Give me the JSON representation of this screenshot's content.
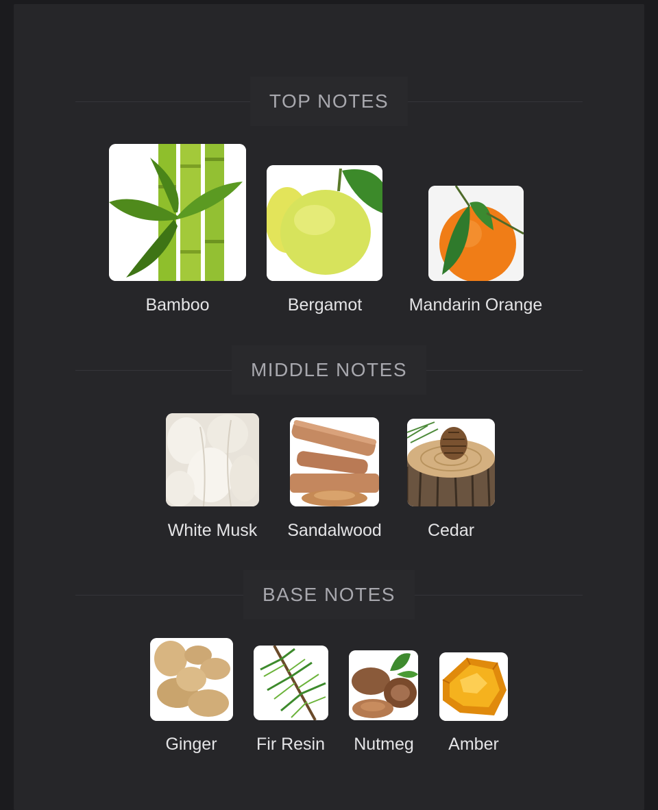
{
  "sections": [
    {
      "title": "TOP NOTES",
      "notes": [
        {
          "label": "Bamboo",
          "icon": "bamboo-image"
        },
        {
          "label": "Bergamot",
          "icon": "bergamot-image"
        },
        {
          "label": "Mandarin Orange",
          "icon": "mandarin-orange-image"
        }
      ]
    },
    {
      "title": "MIDDLE NOTES",
      "notes": [
        {
          "label": "White Musk",
          "icon": "white-musk-image"
        },
        {
          "label": "Sandalwood",
          "icon": "sandalwood-image"
        },
        {
          "label": "Cedar",
          "icon": "cedar-image"
        }
      ]
    },
    {
      "title": "BASE NOTES",
      "notes": [
        {
          "label": "Ginger",
          "icon": "ginger-image"
        },
        {
          "label": "Fir Resin",
          "icon": "fir-resin-image"
        },
        {
          "label": "Nutmeg",
          "icon": "nutmeg-image"
        },
        {
          "label": "Amber",
          "icon": "amber-image"
        }
      ]
    }
  ],
  "colors": {
    "background": "#1b1b1e",
    "card": "#262629",
    "header_text": "#a8a8ae",
    "label_text": "#e4e4e6"
  }
}
